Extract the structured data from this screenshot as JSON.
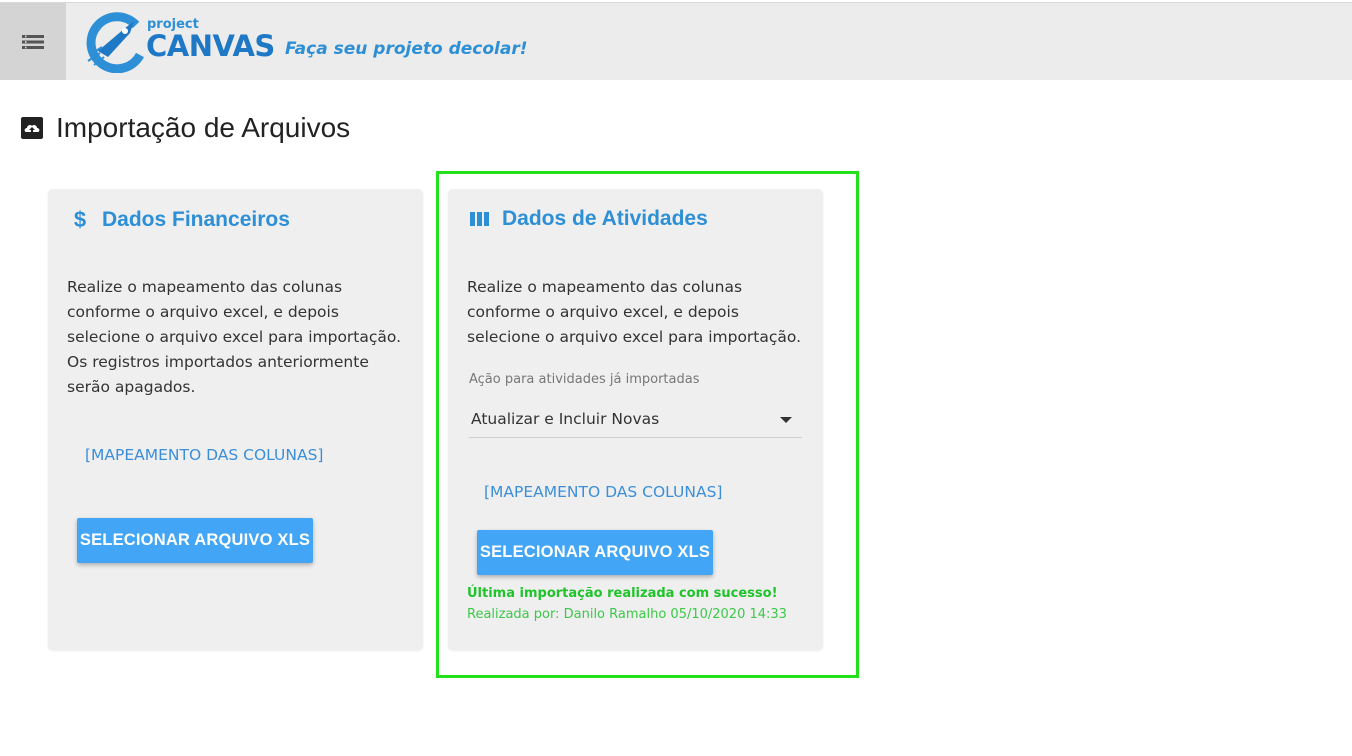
{
  "header": {
    "logo_small": "project",
    "logo_big": "CANVAS",
    "tagline": "Faça seu projeto decolar!",
    "menu_icon": "hamburger-icon"
  },
  "page": {
    "title": "Importação de Arquivos",
    "title_icon": "cloud-upload-icon"
  },
  "cards": [
    {
      "icon": "$",
      "title": "Dados Financeiros",
      "description": "Realize o mapeamento das colunas conforme o arquivo excel, e depois selecione o arquivo excel para importação. Os registros importados anteriormente serão apagados.",
      "map_link": "[MAPEAMENTO DAS COLUNAS]",
      "button": "SELECIONAR ARQUIVO XLS"
    },
    {
      "icon": "view-column-icon",
      "title": "Dados de Atividades",
      "description": "Realize o mapeamento das colunas conforme o arquivo excel, e depois selecione o arquivo excel para importação.",
      "select_label": "Ação para atividades já importadas",
      "select_value": "Atualizar e Incluir Novas",
      "map_link": "[MAPEAMENTO DAS COLUNAS]",
      "button": "SELECIONAR ARQUIVO XLS",
      "status_ok": "Última importação realizada com sucesso!",
      "status_by": "Realizada por: Danilo Ramalho 05/10/2020 14:33"
    }
  ],
  "colors": {
    "accent": "#2d8fd6",
    "button": "#42a5f5",
    "success": "#1fc32a",
    "highlight": "#22e01a"
  }
}
